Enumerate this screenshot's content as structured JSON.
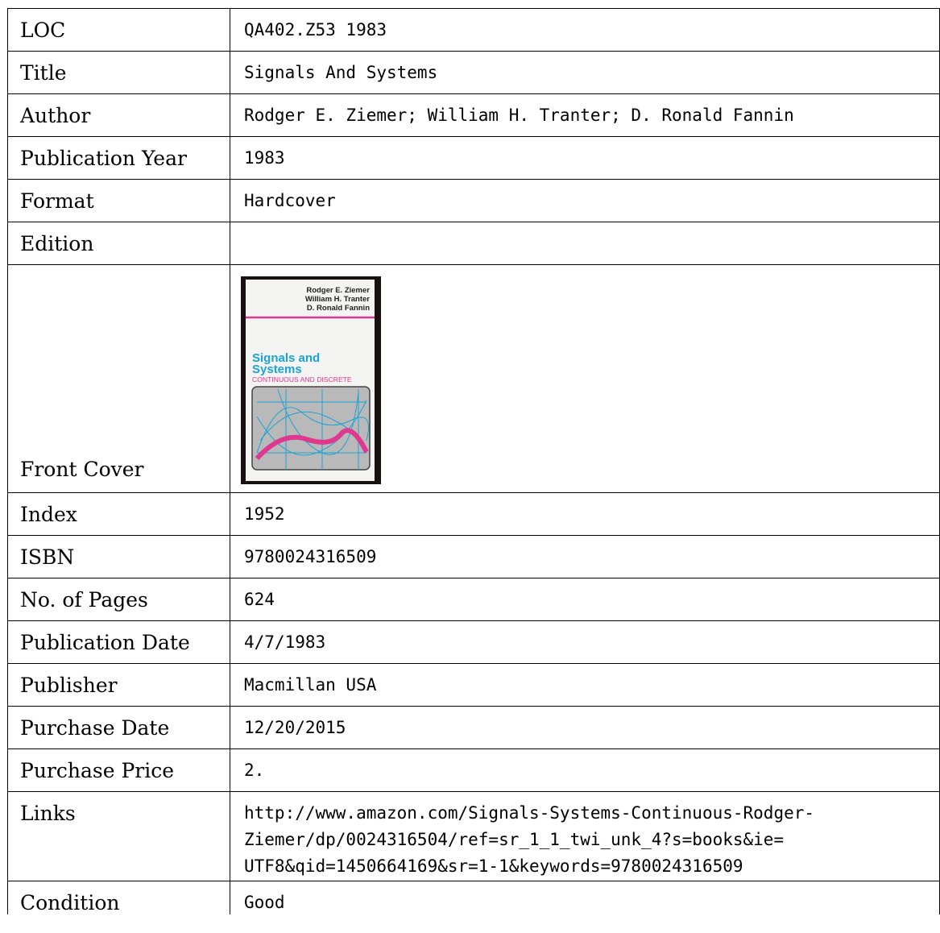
{
  "record": {
    "loc": {
      "label": "LOC",
      "value": "QA402.Z53 1983"
    },
    "title": {
      "label": "Title",
      "value": "Signals And Systems"
    },
    "author": {
      "label": "Author",
      "value": "Rodger E. Ziemer; William H. Tranter; D. Ronald Fannin"
    },
    "publication_year": {
      "label": "Publication Year",
      "value": "1983"
    },
    "format": {
      "label": "Format",
      "value": "Hardcover"
    },
    "edition": {
      "label": "Edition",
      "value": ""
    },
    "front_cover": {
      "label": "Front Cover",
      "cover_authors": [
        "Rodger E. Ziemer",
        "William H. Tranter",
        "D. Ronald Fannin"
      ],
      "cover_title_line1": "Signals and",
      "cover_title_line2": "Systems",
      "cover_subtitle": "CONTINUOUS AND DISCRETE",
      "colors": {
        "title": "#1aa3d6",
        "accent": "#e0378f",
        "frame": "#1a1210",
        "graph_bg": "#b9b9b9"
      }
    },
    "index": {
      "label": "Index",
      "value": "1952"
    },
    "isbn": {
      "label": "ISBN",
      "value": "9780024316509"
    },
    "pages": {
      "label": "No. of Pages",
      "value": "624"
    },
    "publication_date": {
      "label": "Publication Date",
      "value": "4/7/1983"
    },
    "publisher": {
      "label": "Publisher",
      "value": "Macmillan USA"
    },
    "purchase_date": {
      "label": "Purchase Date",
      "value": "12/20/2015"
    },
    "purchase_price": {
      "label": "Purchase Price",
      "value": "2."
    },
    "links": {
      "label": "Links",
      "value": "http://www.amazon.com/Signals-Systems-Continuous-Rodger-Ziemer/dp/0024316504/ref=sr_1_1_twi_unk_4?s=books&ie=UTF8&qid=1450664169&sr=1-1&keywords=9780024316509",
      "lines": [
        "http://www.amazon.com/Signals-Systems-Continuous-Rodger-",
        "Ziemer/dp/0024316504/ref=sr_1_1_twi_unk_4?s=books&ie=",
        "UTF8&qid=1450664169&sr=1-1&keywords=9780024316509"
      ]
    },
    "condition": {
      "label": "Condition",
      "value": "Good"
    }
  }
}
